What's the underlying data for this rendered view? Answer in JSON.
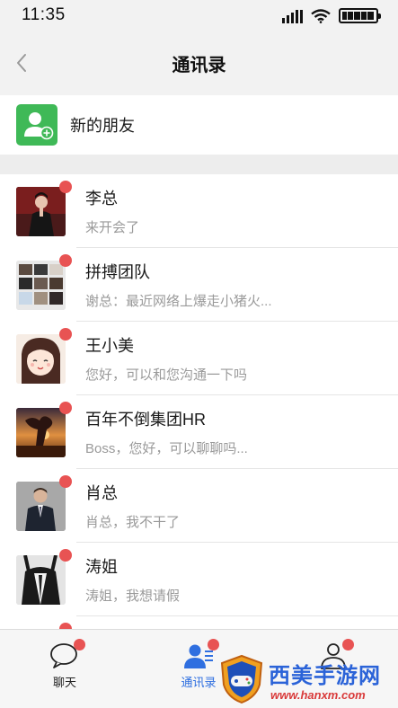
{
  "status_bar": {
    "time": "11:35"
  },
  "nav": {
    "title": "通讯录"
  },
  "new_friends": {
    "label": "新的朋友"
  },
  "contacts": [
    {
      "name": "李总",
      "message": "来开会了",
      "has_unread": true
    },
    {
      "name": "拼搏团队",
      "message": "谢总：最近网络上爆走小猪火...",
      "has_unread": true
    },
    {
      "name": "王小美",
      "message": "您好，可以和您沟通一下吗",
      "has_unread": true
    },
    {
      "name": "百年不倒集团HR",
      "message": "Boss，您好，可以聊聊吗...",
      "has_unread": true
    },
    {
      "name": "肖总",
      "message": "肖总，我不干了",
      "has_unread": true
    },
    {
      "name": "涛姐",
      "message": "涛姐，我想请假",
      "has_unread": true
    }
  ],
  "tabs": [
    {
      "label": "聊天",
      "icon": "chat-bubble-icon",
      "active": false
    },
    {
      "label": "通讯录",
      "icon": "contacts-icon",
      "active": true
    },
    {
      "label": "",
      "icon": "me-icon",
      "active": false
    }
  ],
  "watermark": {
    "title": "西美手游网",
    "url": "www.hanxm.com"
  },
  "colors": {
    "accent": "#2f6fe0",
    "badge": "#e85353",
    "new_friends_icon": "#3fb957"
  }
}
